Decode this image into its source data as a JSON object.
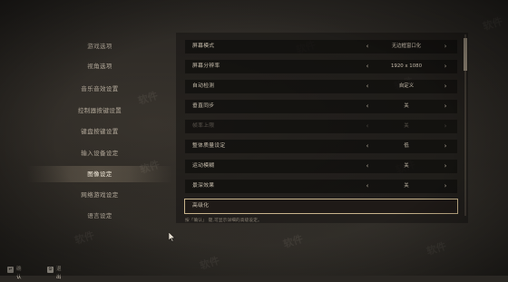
{
  "nav": {
    "items": [
      {
        "label": "游戏选项"
      },
      {
        "label": "视角选项"
      },
      {
        "label": "音乐音效设置"
      },
      {
        "label": "控制器按键设置"
      },
      {
        "label": "键盘按键设置"
      },
      {
        "label": "输入设备设定"
      },
      {
        "label": "图像设定"
      },
      {
        "label": "网络游戏设定"
      },
      {
        "label": "语言设定"
      }
    ],
    "active_index": 6
  },
  "settings": {
    "rows": [
      {
        "label": "屏幕模式",
        "value": "无边框窗口化",
        "disabled": false
      },
      {
        "label": "屏幕分辨率",
        "value": "1920 x 1080",
        "disabled": false
      },
      {
        "label": "自动检测",
        "value": "自定义",
        "disabled": false
      },
      {
        "label": "垂直同步",
        "value": "关",
        "disabled": false
      },
      {
        "label": "帧率上限",
        "value": "关",
        "disabled": true
      },
      {
        "label": "整体质量设定",
        "value": "低",
        "disabled": false
      },
      {
        "label": "运动模糊",
        "value": "关",
        "disabled": false
      },
      {
        "label": "景深效果",
        "value": "关",
        "disabled": false
      }
    ],
    "selected_row": {
      "label": "高级化"
    }
  },
  "hint": "按「确认」 键,可显示详细的高级设定。",
  "bottom": {
    "keys": [
      {
        "cap": "↵",
        "label": "确认"
      },
      {
        "cap": "⎋",
        "label": "退出"
      }
    ]
  },
  "watermark": "软件"
}
